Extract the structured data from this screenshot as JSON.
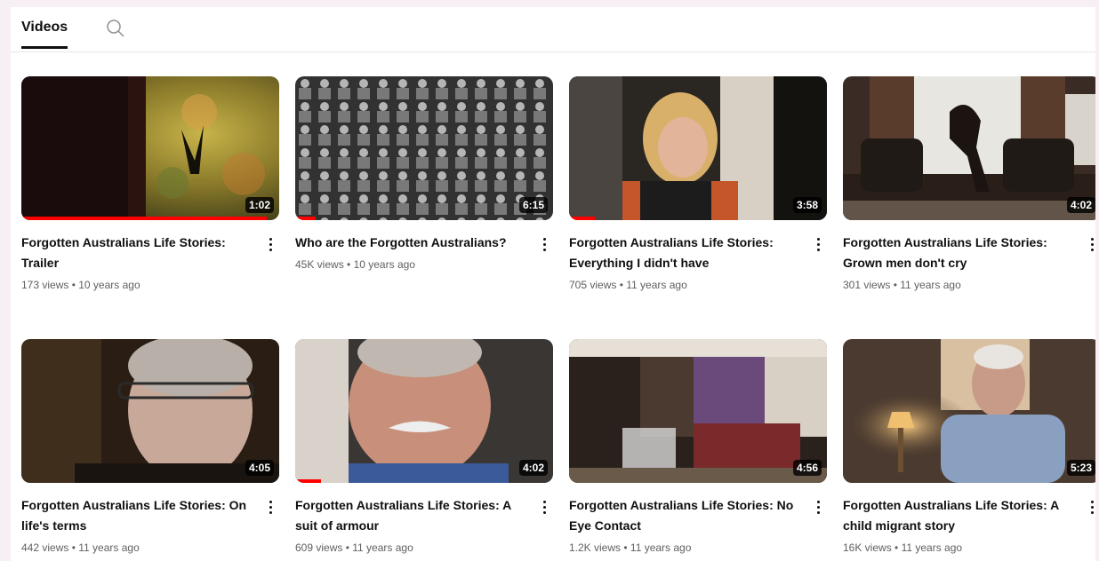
{
  "tabs": {
    "videos_label": "Videos"
  },
  "icons": {
    "search": "search-icon",
    "more": "more-vertical-icon"
  },
  "colors": {
    "progress": "#ff0000",
    "accent_text": "#0f0f0f",
    "muted_text": "#606060"
  },
  "videos": [
    {
      "title": "Forgotten Australians Life Stories: Trailer",
      "views": "173 views",
      "age": "10 years ago",
      "duration": "1:02",
      "watched": 0.95
    },
    {
      "title": "Who are the Forgotten Australians?",
      "views": "45K views",
      "age": "10 years ago",
      "duration": "6:15",
      "watched": 0.08
    },
    {
      "title": "Forgotten Australians Life Stories: Everything I didn't have",
      "views": "705 views",
      "age": "11 years ago",
      "duration": "3:58",
      "watched": 0.1
    },
    {
      "title": "Forgotten Australians Life Stories: Grown men don't cry",
      "views": "301 views",
      "age": "11 years ago",
      "duration": "4:02",
      "watched": 0
    },
    {
      "title": "Forgotten Australians Life Stories: On life's terms",
      "views": "442 views",
      "age": "11 years ago",
      "duration": "4:05",
      "watched": 0
    },
    {
      "title": "Forgotten Australians Life Stories: A suit of armour",
      "views": "609 views",
      "age": "11 years ago",
      "duration": "4:02",
      "watched": 0.1
    },
    {
      "title": "Forgotten Australians Life Stories: No Eye Contact",
      "views": "1.2K views",
      "age": "11 years ago",
      "duration": "4:56",
      "watched": 0
    },
    {
      "title": "Forgotten Australians Life Stories: A child migrant story",
      "views": "16K views",
      "age": "11 years ago",
      "duration": "5:23",
      "watched": 0
    }
  ]
}
